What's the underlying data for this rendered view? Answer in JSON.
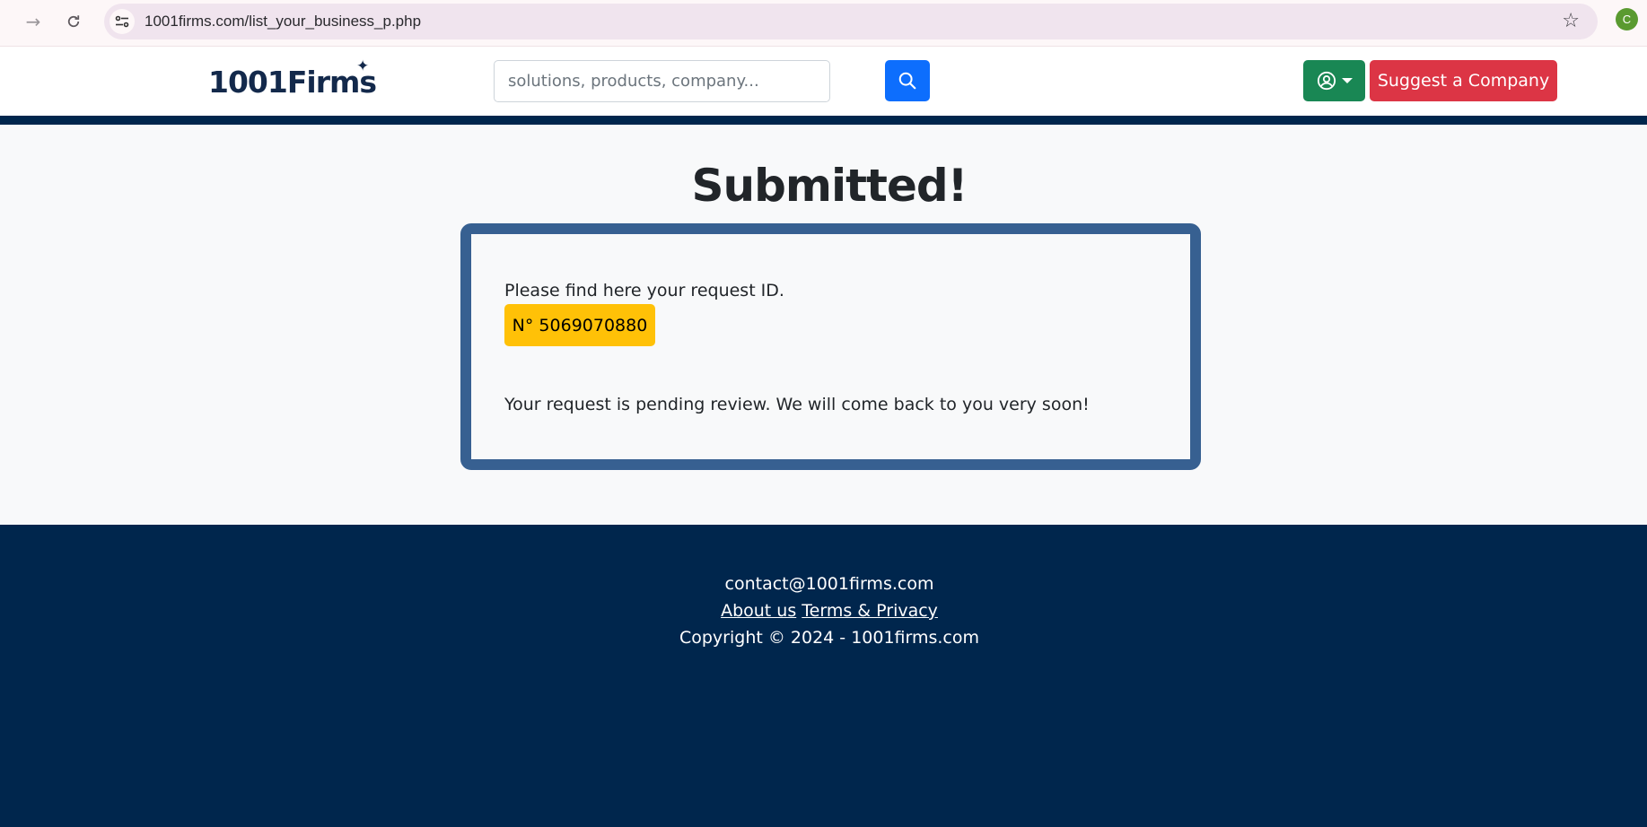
{
  "browser": {
    "url": "1001firms.com/list_your_business_p.php",
    "profile_initial": "C"
  },
  "header": {
    "logo": "1001Firms",
    "search_placeholder": "solutions, products, company...",
    "suggest_label": "Suggest a Company"
  },
  "main": {
    "title": "Submitted!",
    "intro": "Please find here your request ID.",
    "request_id": "N° 5069070880",
    "pending": "Your request is pending review. We will come back to you very soon!"
  },
  "footer": {
    "email": "contact@1001firms.com",
    "about": "About us",
    "terms": "Terms & Privacy",
    "copyright": "Copyright © 2024 - 1001firms.com"
  },
  "colors": {
    "navy": "#00264d",
    "card_border": "#376091",
    "badge": "#ffc107",
    "search_button": "#0d6efd",
    "user_button": "#198754",
    "suggest_button": "#dc3545"
  }
}
